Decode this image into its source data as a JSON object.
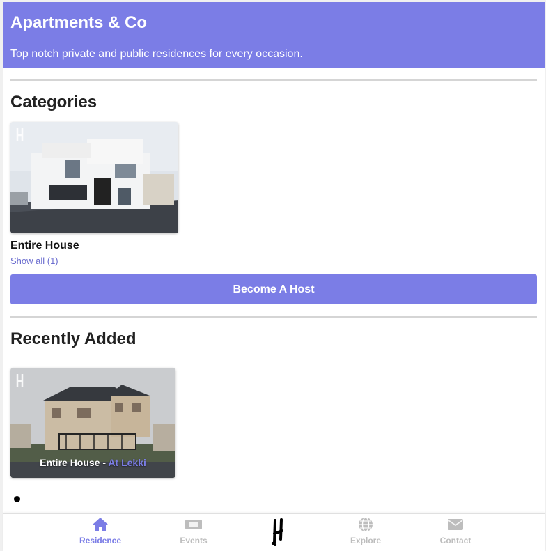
{
  "header": {
    "title": "Apartments & Co",
    "subtitle": "Top notch private and public residences for every occasion."
  },
  "categories": {
    "heading": "Categories",
    "items": [
      {
        "label": "Entire House",
        "show_all": "Show all (1)"
      }
    ]
  },
  "become_host": {
    "label": "Become A Host"
  },
  "recently_added": {
    "heading": "Recently Added",
    "items": [
      {
        "title": "Entire House",
        "separator": " - ",
        "location": "At Lekki"
      }
    ]
  },
  "carousel": {
    "active_index": 1,
    "total": 1
  },
  "bottom_nav": {
    "items": [
      {
        "label": "Residence",
        "icon": "home-icon",
        "active": true
      },
      {
        "label": "Events",
        "icon": "ticket-icon",
        "active": false
      },
      {
        "label": "",
        "icon": "brand-logo-icon",
        "active": false
      },
      {
        "label": "Explore",
        "icon": "globe-icon",
        "active": false
      },
      {
        "label": "Contact",
        "icon": "envelope-icon",
        "active": false
      }
    ]
  },
  "colors": {
    "accent": "#7b7de6",
    "inactive_nav": "#bdbdbd",
    "divider": "#d5d5d5"
  }
}
